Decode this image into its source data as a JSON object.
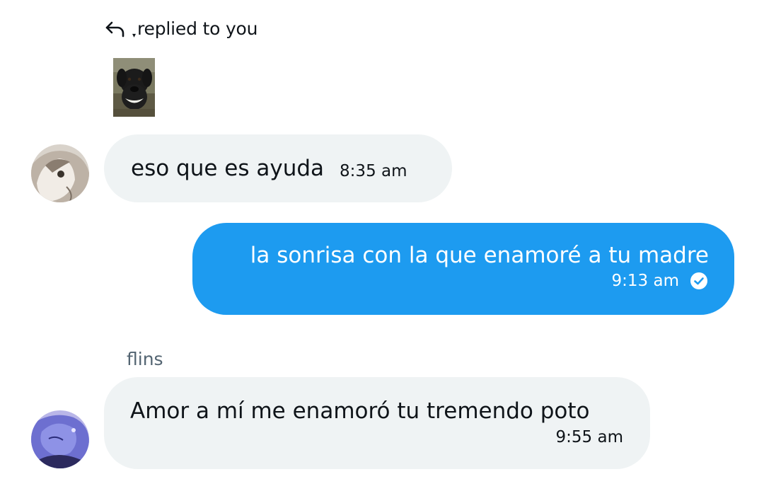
{
  "reply_header": {
    "text": "replied to you",
    "icon": "reply-arrow-icon"
  },
  "messages": [
    {
      "direction": "incoming",
      "text": "eso que es ayuda",
      "time": "8:35 am"
    },
    {
      "direction": "outgoing",
      "text": "la sonrisa con la que enamoré a tu madre",
      "time": "9:13 am",
      "status_icon": "read-check-icon"
    },
    {
      "direction": "incoming",
      "sender": "flins",
      "text": "Amor a mí me enamoró tu tremendo poto",
      "time": "9:55 am"
    }
  ],
  "colors": {
    "outgoing_bubble": "#1d9bf0",
    "incoming_bubble": "#eff3f4",
    "primary_text": "#0f1419",
    "secondary_text": "#536471"
  }
}
